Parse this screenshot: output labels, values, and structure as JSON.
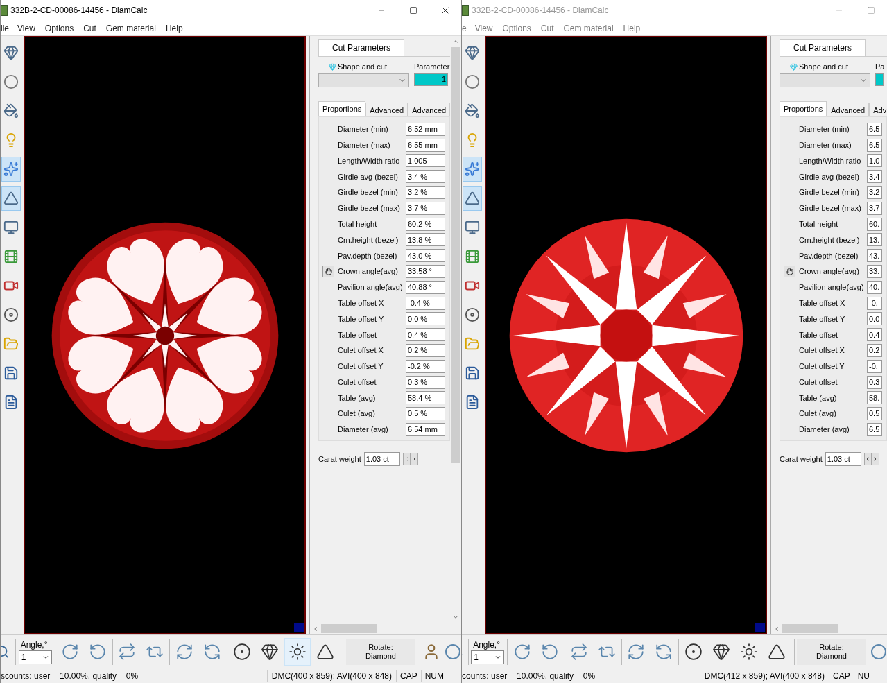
{
  "windows": [
    {
      "title": "332B-2-CD-00086-14456 - DiamCalc",
      "active": true,
      "caption_buttons": [
        {
          "kind": "minimize"
        },
        {
          "kind": "maximize"
        },
        {
          "kind": "close"
        }
      ],
      "menu": [
        "ile",
        "View",
        "Options",
        "Cut",
        "Gem material",
        "Help"
      ],
      "side_tools": [
        {
          "kind": "gem",
          "selected": false
        },
        {
          "kind": "ring",
          "selected": false
        },
        {
          "kind": "paint",
          "selected": false
        },
        {
          "kind": "bulb",
          "selected": false
        },
        {
          "kind": "sparkle",
          "selected": true
        },
        {
          "kind": "prism",
          "selected": true
        },
        {
          "kind": "monitor",
          "selected": false
        },
        {
          "kind": "film",
          "selected": false
        },
        {
          "kind": "video",
          "selected": false
        },
        {
          "kind": "disc",
          "selected": false
        },
        {
          "kind": "folder",
          "selected": false
        },
        {
          "kind": "save",
          "selected": false
        },
        {
          "kind": "document",
          "selected": false
        }
      ],
      "view": {
        "kind": "hearts"
      },
      "panel": {
        "tab": "Cut Parameters",
        "shape_label": "Shape and cut",
        "parameter_label": "Parameter",
        "parameter_value": "1",
        "tabs": [
          {
            "label": "Proportions",
            "selected": true
          },
          {
            "label": "Advanced",
            "selected": false
          },
          {
            "label": "Advanced",
            "selected": false
          }
        ],
        "rows": [
          {
            "label": "Diameter (min)",
            "value": "6.52 mm",
            "button": false
          },
          {
            "label": "Diameter (max)",
            "value": "6.55 mm",
            "button": false
          },
          {
            "label": "Length/Width ratio",
            "value": "1.005",
            "button": false
          },
          {
            "label": "Girdle avg (bezel)",
            "value": "3.4 %",
            "button": false
          },
          {
            "label": "Girdle bezel (min)",
            "value": "3.2 %",
            "button": false
          },
          {
            "label": "Girdle bezel (max)",
            "value": "3.7 %",
            "button": false
          },
          {
            "label": "Total height",
            "value": "60.2 %",
            "button": false
          },
          {
            "label": "Crn.height (bezel)",
            "value": "13.8 %",
            "button": false
          },
          {
            "label": "Pav.depth (bezel)",
            "value": "43.0 %",
            "button": false
          },
          {
            "label": "Crown angle(avg)",
            "value": "33.58 °",
            "button": true
          },
          {
            "label": "Pavilion angle(avg)",
            "value": "40.88 °",
            "button": false
          },
          {
            "label": "Table offset X",
            "value": "-0.4 %",
            "button": false
          },
          {
            "label": "Table offset Y",
            "value": "0.0 %",
            "button": false
          },
          {
            "label": "Table offset",
            "value": "0.4 %",
            "button": false
          },
          {
            "label": "Culet offset X",
            "value": "0.2 %",
            "button": false
          },
          {
            "label": "Culet offset Y",
            "value": "-0.2 %",
            "button": false
          },
          {
            "label": "Culet offset",
            "value": "0.3 %",
            "button": false
          },
          {
            "label": "Table (avg)",
            "value": "58.4 %",
            "button": false
          },
          {
            "label": "Culet (avg)",
            "value": "0.5 %",
            "button": false
          },
          {
            "label": "Diameter (avg)",
            "value": "6.54 mm",
            "button": false
          }
        ],
        "carat_label": "Carat weight",
        "carat_value": "1.03 ct"
      },
      "toolbar": {
        "angle_label": "Angle,°",
        "angle_value": "1",
        "tools": [
          {
            "kind": "rotate-cw",
            "selected": false
          },
          {
            "kind": "rotate-ccw",
            "selected": false
          },
          {
            "kind": "spin-left",
            "selected": false
          },
          {
            "kind": "spin-right",
            "selected": false
          },
          {
            "kind": "tilt-down",
            "selected": false
          },
          {
            "kind": "tilt-up",
            "selected": false
          },
          {
            "kind": "top-view",
            "selected": false
          },
          {
            "kind": "side-view",
            "selected": false
          },
          {
            "kind": "star-view",
            "selected": true
          },
          {
            "kind": "bottom-view",
            "selected": false
          }
        ],
        "rotate_label": "Rotate:",
        "rotate_target": "Diamond",
        "extras": true
      },
      "status": [
        "scounts: user = 10.00%, quality = 0%",
        "DMC(400 x 859); AVI(400 x 848)",
        "CAP",
        "NUM"
      ]
    },
    {
      "title": "332B-2-CD-00086-14456 - DiamCalc",
      "active": false,
      "caption_buttons": [
        {
          "kind": "minimize"
        },
        {
          "kind": "maximize"
        }
      ],
      "menu": [
        "e",
        "View",
        "Options",
        "Cut",
        "Gem material",
        "Help"
      ],
      "side_tools": [
        {
          "kind": "gem",
          "selected": false
        },
        {
          "kind": "ring",
          "selected": false
        },
        {
          "kind": "paint",
          "selected": false
        },
        {
          "kind": "bulb",
          "selected": false
        },
        {
          "kind": "sparkle",
          "selected": true
        },
        {
          "kind": "prism",
          "selected": true
        },
        {
          "kind": "monitor",
          "selected": false
        },
        {
          "kind": "film",
          "selected": false
        },
        {
          "kind": "video",
          "selected": false
        },
        {
          "kind": "disc",
          "selected": false
        },
        {
          "kind": "folder",
          "selected": false
        },
        {
          "kind": "save",
          "selected": false
        },
        {
          "kind": "document",
          "selected": false
        }
      ],
      "view": {
        "kind": "arrows"
      },
      "panel": {
        "tab": "Cut Parameters",
        "shape_label": "Shape and cut",
        "parameter_label": "Pa",
        "tabs": [
          {
            "label": "Proportions",
            "selected": true
          },
          {
            "label": "Advanced",
            "selected": false
          },
          {
            "label": "Adv",
            "selected": false
          }
        ],
        "rows": [
          {
            "label": "Diameter (min)",
            "value": "6.5",
            "button": false
          },
          {
            "label": "Diameter (max)",
            "value": "6.5",
            "button": false
          },
          {
            "label": "Length/Width ratio",
            "value": "1.0",
            "button": false
          },
          {
            "label": "Girdle avg (bezel)",
            "value": "3.4",
            "button": false
          },
          {
            "label": "Girdle bezel (min)",
            "value": "3.2",
            "button": false
          },
          {
            "label": "Girdle bezel (max)",
            "value": "3.7",
            "button": false
          },
          {
            "label": "Total height",
            "value": "60.",
            "button": false
          },
          {
            "label": "Crn.height (bezel)",
            "value": "13.",
            "button": false
          },
          {
            "label": "Pav.depth (bezel)",
            "value": "43.",
            "button": false
          },
          {
            "label": "Crown angle(avg)",
            "value": "33.",
            "button": true
          },
          {
            "label": "Pavilion angle(avg)",
            "value": "40.",
            "button": false
          },
          {
            "label": "Table offset X",
            "value": "-0.",
            "button": false
          },
          {
            "label": "Table offset Y",
            "value": "0.0",
            "button": false
          },
          {
            "label": "Table offset",
            "value": "0.4",
            "button": false
          },
          {
            "label": "Culet offset X",
            "value": "0.2",
            "button": false
          },
          {
            "label": "Culet offset Y",
            "value": "-0.",
            "button": false
          },
          {
            "label": "Culet offset",
            "value": "0.3",
            "button": false
          },
          {
            "label": "Table (avg)",
            "value": "58.",
            "button": false
          },
          {
            "label": "Culet (avg)",
            "value": "0.5",
            "button": false
          },
          {
            "label": "Diameter (avg)",
            "value": "6.5",
            "button": false
          }
        ],
        "carat_label": "Carat weight",
        "carat_value": "1.03 ct"
      },
      "toolbar": {
        "angle_label": "Angle,°",
        "angle_value": "1",
        "tools": [
          {
            "kind": "rotate-cw",
            "selected": false
          },
          {
            "kind": "rotate-ccw",
            "selected": false
          },
          {
            "kind": "spin-left",
            "selected": false
          },
          {
            "kind": "spin-right",
            "selected": false
          },
          {
            "kind": "tilt-down",
            "selected": false
          },
          {
            "kind": "tilt-up",
            "selected": false
          },
          {
            "kind": "top-view",
            "selected": false
          },
          {
            "kind": "side-view",
            "selected": false
          },
          {
            "kind": "star-view",
            "selected": false
          },
          {
            "kind": "bottom-view",
            "selected": false
          }
        ],
        "rotate_label": "Rotate:",
        "rotate_target": "Diamond",
        "extras": false
      },
      "status": [
        "counts: user = 10.00%, quality = 0%",
        "DMC(412 x 859); AVI(400 x 848)",
        "CAP",
        "NU"
      ]
    }
  ]
}
